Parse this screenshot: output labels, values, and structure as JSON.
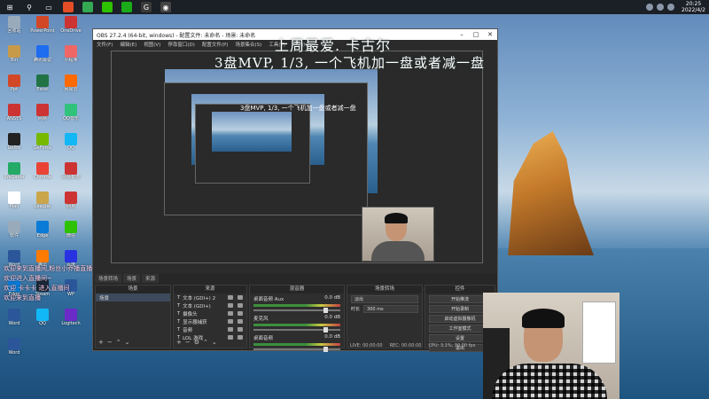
{
  "taskbar": {
    "icons": [
      {
        "name": "windows-start-icon",
        "color": "#1b1f26",
        "glyph": "⊞"
      },
      {
        "name": "search-icon",
        "color": "#1b1f26",
        "glyph": "⚲"
      },
      {
        "name": "taskview-icon",
        "color": "#1b1f26",
        "glyph": "▭"
      },
      {
        "name": "browser-red-icon",
        "color": "#e44d26",
        "glyph": ""
      },
      {
        "name": "chrome-icon",
        "color": "#34a853",
        "glyph": ""
      },
      {
        "name": "wechat-icon",
        "color": "#2dc100",
        "glyph": ""
      },
      {
        "name": "app-green-icon",
        "color": "#1aad19",
        "glyph": ""
      },
      {
        "name": "app-orange-icon",
        "color": "#3a3a3a",
        "glyph": "G"
      },
      {
        "name": "obs-taskbar-icon",
        "color": "#444",
        "glyph": "◉"
      }
    ],
    "clock_time": "20:25",
    "clock_date": "2022/4/2"
  },
  "desktop": {
    "col1": [
      {
        "label": "回收站",
        "color": "#9ab"
      },
      {
        "label": "Bin",
        "color": "#c79a4a"
      },
      {
        "label": "Ppt",
        "color": "#d24726"
      },
      {
        "label": "ANSYS",
        "color": "#c33"
      },
      {
        "label": "GoPro",
        "color": "#222"
      },
      {
        "label": "WeGame",
        "color": "#2a6"
      },
      {
        "label": "Mail",
        "color": "#fff"
      },
      {
        "label": "软件",
        "color": "#9ab"
      },
      {
        "label": "Word",
        "color": "#2b579a"
      },
      {
        "label": "Edge",
        "color": "#0a7bd7"
      },
      {
        "label": "Word",
        "color": "#2b579a"
      },
      {
        "label": "Word",
        "color": "#2b579a"
      }
    ],
    "col2": [
      {
        "label": "PowerPoint",
        "color": "#d24726"
      },
      {
        "label": "腾讯会议",
        "color": "#1e6cf0"
      },
      {
        "label": "Excel",
        "color": "#217346"
      },
      {
        "label": "网易",
        "color": "#c33"
      },
      {
        "label": "GeForce",
        "color": "#76b900"
      },
      {
        "label": "Chrome",
        "color": "#ea4335"
      },
      {
        "label": "League",
        "color": "#caa54a"
      },
      {
        "label": "Edge",
        "color": "#0a7bd7"
      },
      {
        "label": "腾讯",
        "color": "#ff7a00"
      },
      {
        "label": "Steam",
        "color": "#1b2838"
      },
      {
        "label": "QQ",
        "color": "#12b7f5"
      }
    ],
    "col3": [
      {
        "label": "OneDrive",
        "color": "#c33"
      },
      {
        "label": "小程序",
        "color": "#e66"
      },
      {
        "label": "网易云",
        "color": "#ff6a00"
      },
      {
        "label": "QQ音乐",
        "color": "#31c27c"
      },
      {
        "label": "QQ",
        "color": "#12b7f5"
      },
      {
        "label": "网易有道",
        "color": "#c33"
      },
      {
        "label": "网易",
        "color": "#c33"
      },
      {
        "label": "微信",
        "color": "#2dc100"
      },
      {
        "label": "百度",
        "color": "#2932e1"
      },
      {
        "label": "WP",
        "color": "#2b579a"
      },
      {
        "label": "Logitech",
        "color": "#6a2bc7"
      }
    ]
  },
  "obs": {
    "title": "OBS 27.2.4 (64-bit, windows) - 配置文件: 未命名 - 场景: 未命名",
    "menu": [
      "文件(F)",
      "编辑(E)",
      "视图(V)",
      "停靠窗口(D)",
      "配置文件(P)",
      "场景集合(S)",
      "工具(T)",
      "帮助(H)"
    ],
    "tabs": [
      "场景转场",
      "场景",
      "来源"
    ],
    "scenes_header": "场景",
    "scenes": [
      "场景"
    ],
    "sources_header": "来源",
    "sources": [
      "文本 (GDI+) 2",
      "文本 (GDI+)",
      "摄像头",
      "显示器捕获",
      "音频",
      "LOL 游戏"
    ],
    "mixer_header": "混音器",
    "mixer": [
      {
        "name": "桌面音频 Aux",
        "db": "0.0 dB"
      },
      {
        "name": "麦克风",
        "db": "0.0 dB"
      },
      {
        "name": "桌面音频",
        "db": "0.0 dB"
      }
    ],
    "transitions_header": "场景转场",
    "transition_type": "淡出",
    "duration_label": "时长",
    "duration_value": "300 ms",
    "controls_header": "控件",
    "controls": [
      "开始推流",
      "开始录制",
      "启动虚拟摄像机",
      "工作室模式",
      "设置",
      "退出"
    ],
    "status": {
      "live": "LIVE: 00:00:00",
      "rec": "REC: 00:00:00",
      "cpu": "CPU: 3.1%, 30.00 fps"
    }
  },
  "overlay": {
    "line1": "上周最爱. 卡古尔",
    "line2": "3盘MVP, 1/3, 一个飞机加一盘或者减一盘",
    "nested_line": "3盘MVP, 1/3, 一个飞机加一盘或者减一盘"
  },
  "chat": [
    "欢迎来到直播间,粉丝小乔播直播",
    "欢迎进入直播间~",
    "欢迎  卡卡卡 进入直播间",
    "欢迎来到直播"
  ]
}
